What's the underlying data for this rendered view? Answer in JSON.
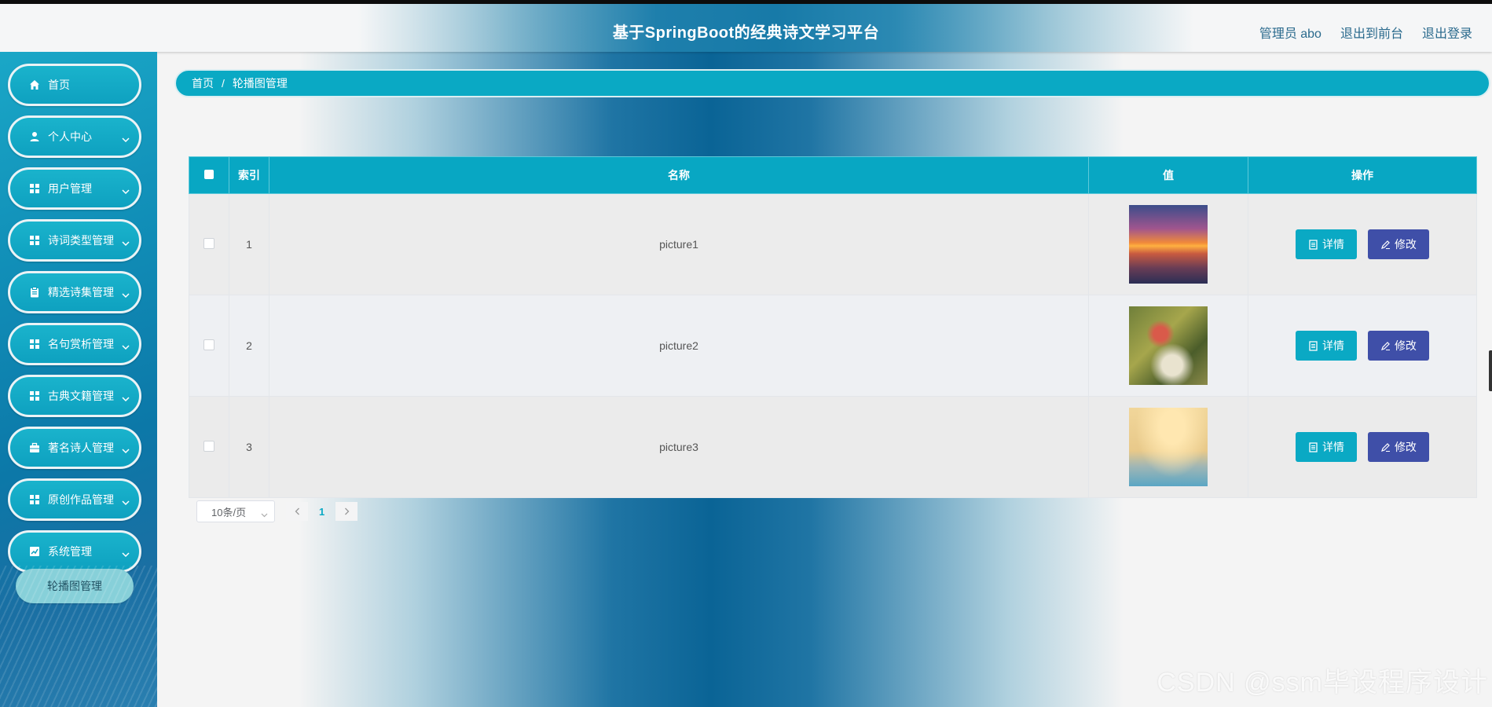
{
  "header": {
    "title": "基于SpringBoot的经典诗文学习平台",
    "links": [
      "管理员 abo",
      "退出到前台",
      "退出登录"
    ]
  },
  "sidebar": {
    "items": [
      {
        "label": "首页",
        "icon": "home-icon",
        "has_children": false
      },
      {
        "label": "个人中心",
        "icon": "user-icon",
        "has_children": true
      },
      {
        "label": "用户管理",
        "icon": "grid-icon",
        "has_children": true
      },
      {
        "label": "诗词类型管理",
        "icon": "grid-icon",
        "has_children": true
      },
      {
        "label": "精选诗集管理",
        "icon": "clipboard-icon",
        "has_children": true
      },
      {
        "label": "名句赏析管理",
        "icon": "grid-icon",
        "has_children": true
      },
      {
        "label": "古典文籍管理",
        "icon": "grid-icon",
        "has_children": true
      },
      {
        "label": "著名诗人管理",
        "icon": "briefcase-icon",
        "has_children": true
      },
      {
        "label": "原创作品管理",
        "icon": "grid-icon",
        "has_children": true
      },
      {
        "label": "系统管理",
        "icon": "chart-icon",
        "has_children": true
      }
    ],
    "submenu": {
      "label": "轮播图管理"
    }
  },
  "breadcrumb": {
    "home": "首页",
    "separator": "/",
    "current": "轮播图管理"
  },
  "table": {
    "headers": {
      "index": "索引",
      "name": "名称",
      "value": "值",
      "actions": "操作"
    },
    "rows": [
      {
        "index": "1",
        "name": "picture1",
        "thumb": "sunset-image"
      },
      {
        "index": "2",
        "name": "picture2",
        "thumb": "flowers-image"
      },
      {
        "index": "3",
        "name": "picture3",
        "thumb": "tree-image"
      }
    ],
    "detail_label": "详情",
    "edit_label": "修改"
  },
  "pagination": {
    "page_size": "10条/页",
    "current_page": "1"
  },
  "watermark": "CSDN @ssm毕设程序设计",
  "colors": {
    "primary": "#0aa9c4",
    "edit": "#3f4fa8",
    "sidebar": "#118fb8"
  }
}
